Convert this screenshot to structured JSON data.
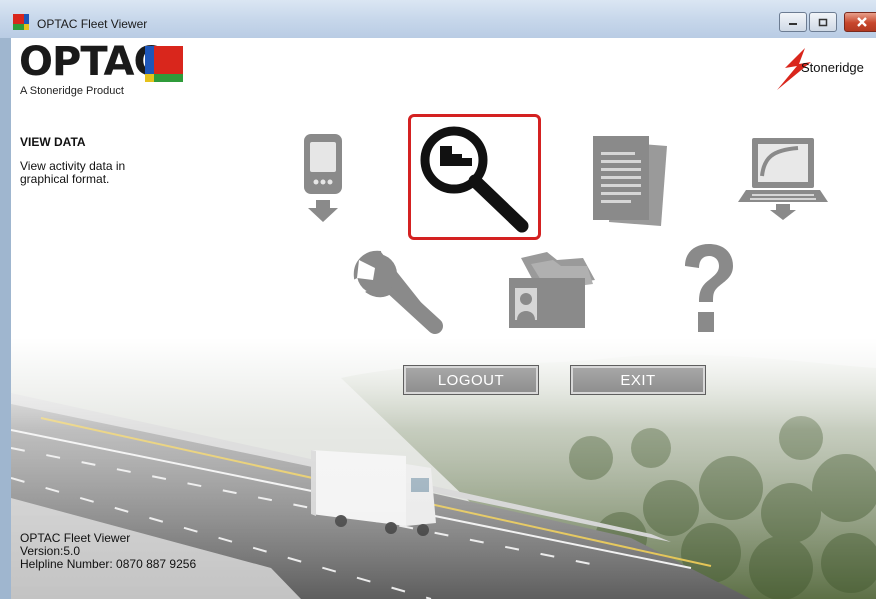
{
  "window": {
    "title": "OPTAC Fleet Viewer",
    "controls": [
      "minimize",
      "maximize",
      "close"
    ]
  },
  "header": {
    "logo": "OPTAC",
    "logo_sub": "A Stoneridge Product",
    "brand": "Stoneridge"
  },
  "info": {
    "title": "VIEW DATA",
    "description": "View activity data in graphical format."
  },
  "menu": {
    "items": [
      {
        "id": "download",
        "icon": "download-device-icon",
        "selected": false
      },
      {
        "id": "view-data",
        "icon": "magnifier-icon",
        "selected": true
      },
      {
        "id": "reports",
        "icon": "documents-icon",
        "selected": false
      },
      {
        "id": "laptop-download",
        "icon": "laptop-download-icon",
        "selected": false
      },
      {
        "id": "settings",
        "icon": "wrench-icon",
        "selected": false
      },
      {
        "id": "drivers",
        "icon": "driver-cards-icon",
        "selected": false
      },
      {
        "id": "help",
        "icon": "question-mark-icon",
        "selected": false
      }
    ]
  },
  "buttons": {
    "logout": "LOGOUT",
    "exit": "EXIT"
  },
  "footer": {
    "app_name": "OPTAC Fleet Viewer",
    "version": "Version:5.0",
    "helpline": "Helpline Number: 0870 887 9256"
  },
  "colors": {
    "selection": "#d42121",
    "icon_gray": "#8a8a8a",
    "button_gray": "#9b9b9b",
    "logo_red": "#d9261c",
    "logo_blue": "#1e56b8",
    "logo_green": "#2f9b3a"
  }
}
